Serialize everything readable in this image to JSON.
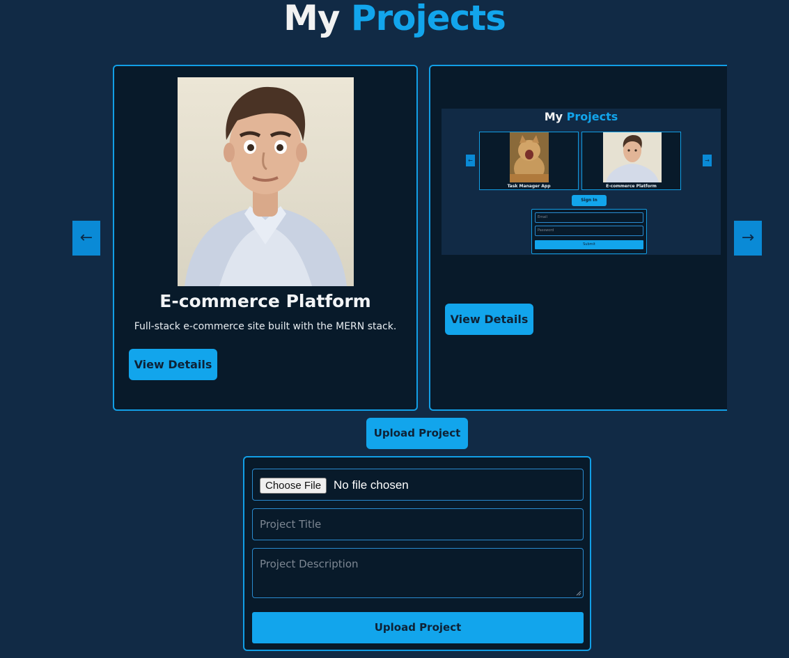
{
  "header": {
    "title_white": "My",
    "title_blue": "Projects"
  },
  "carousel": {
    "prev_label": "←",
    "next_label": "→",
    "cards": [
      {
        "title": "E-commerce Platform",
        "description": "Full-stack e-commerce site built with the MERN stack.",
        "button": "View Details",
        "image": "portrait-photo"
      },
      {
        "title": "",
        "description": "",
        "button": "View Details",
        "image": "project-screenshot"
      }
    ]
  },
  "mini_screenshot": {
    "title_white": "My",
    "title_blue": "Projects",
    "prev": "←",
    "next": "→",
    "card1_label": "Task Manager App",
    "card2_label": "E-commerce Platform",
    "signin": "Sign In",
    "email_placeholder": "Email",
    "password_placeholder": "Password",
    "submit": "Submit"
  },
  "upload": {
    "toggle_label": "Upload Project",
    "file_button": "Choose File",
    "file_status": "No file chosen",
    "title_placeholder": "Project Title",
    "description_placeholder": "Project Description",
    "submit_label": "Upload Project"
  },
  "colors": {
    "background": "#112a45",
    "accent": "#12a5ec",
    "card_bg": "#081a2a"
  }
}
